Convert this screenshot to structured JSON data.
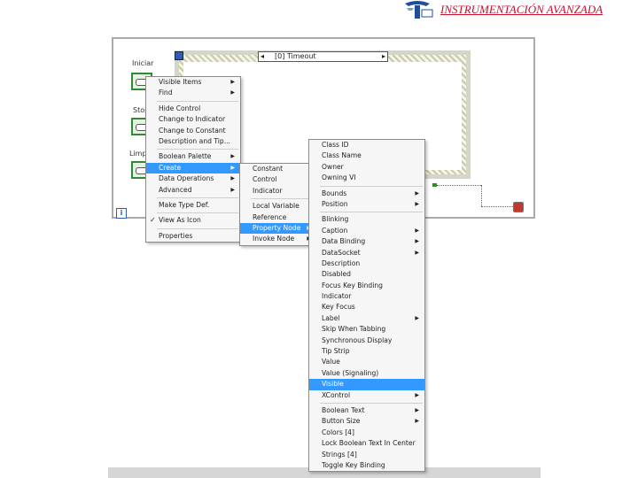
{
  "header": {
    "title": "INSTRUMENTACIÓN AVANZADA"
  },
  "diagram": {
    "controls": [
      "Iniciar",
      "Stop",
      "Limp"
    ],
    "event_selector": {
      "left_arrow": "◂",
      "text": "[0] Timeout",
      "right_arrow": "▸"
    },
    "info_glyph": "i"
  },
  "context_menu": {
    "items": [
      {
        "label": "Visible Items",
        "sub": true
      },
      {
        "label": "Find",
        "sub": true
      },
      {
        "sep": true
      },
      {
        "label": "Hide Control"
      },
      {
        "label": "Change to Indicator"
      },
      {
        "label": "Change to Constant"
      },
      {
        "label": "Description and Tip..."
      },
      {
        "sep": true
      },
      {
        "label": "Boolean Palette",
        "sub": true
      },
      {
        "label": "Create",
        "sub": true,
        "selected": true
      },
      {
        "label": "Data Operations",
        "sub": true
      },
      {
        "label": "Advanced",
        "sub": true
      },
      {
        "sep": true
      },
      {
        "label": "Make Type Def."
      },
      {
        "sep": true
      },
      {
        "label": "View As Icon",
        "checked": true
      },
      {
        "sep": true
      },
      {
        "label": "Properties"
      }
    ]
  },
  "create_menu": {
    "items": [
      {
        "label": "Constant"
      },
      {
        "label": "Control"
      },
      {
        "label": "Indicator"
      },
      {
        "sep": true
      },
      {
        "label": "Local Variable"
      },
      {
        "label": "Reference"
      },
      {
        "label": "Property Node",
        "sub": true,
        "selected": true
      },
      {
        "label": "Invoke Node",
        "sub": true
      }
    ]
  },
  "property_menu": {
    "items": [
      {
        "label": "Class ID"
      },
      {
        "label": "Class Name"
      },
      {
        "label": "Owner"
      },
      {
        "label": "Owning VI"
      },
      {
        "sep": true
      },
      {
        "label": "Bounds",
        "sub": true
      },
      {
        "label": "Position",
        "sub": true
      },
      {
        "sep": true
      },
      {
        "label": "Blinking"
      },
      {
        "label": "Caption",
        "sub": true
      },
      {
        "label": "Data Binding",
        "sub": true
      },
      {
        "label": "DataSocket",
        "sub": true
      },
      {
        "label": "Description"
      },
      {
        "label": "Disabled"
      },
      {
        "label": "Focus Key Binding"
      },
      {
        "label": "Indicator"
      },
      {
        "label": "Key Focus"
      },
      {
        "label": "Label",
        "sub": true
      },
      {
        "label": "Skip When Tabbing"
      },
      {
        "label": "Synchronous Display"
      },
      {
        "label": "Tip Strip"
      },
      {
        "label": "Value"
      },
      {
        "label": "Value (Signaling)"
      },
      {
        "label": "Visible",
        "selected": true
      },
      {
        "label": "XControl",
        "sub": true
      },
      {
        "sep": true
      },
      {
        "label": "Boolean Text",
        "sub": true
      },
      {
        "label": "Button Size",
        "sub": true
      },
      {
        "label": "Colors [4]"
      },
      {
        "label": "Lock Boolean Text In Center"
      },
      {
        "label": "Strings [4]"
      },
      {
        "label": "Toggle Key Binding"
      }
    ]
  }
}
